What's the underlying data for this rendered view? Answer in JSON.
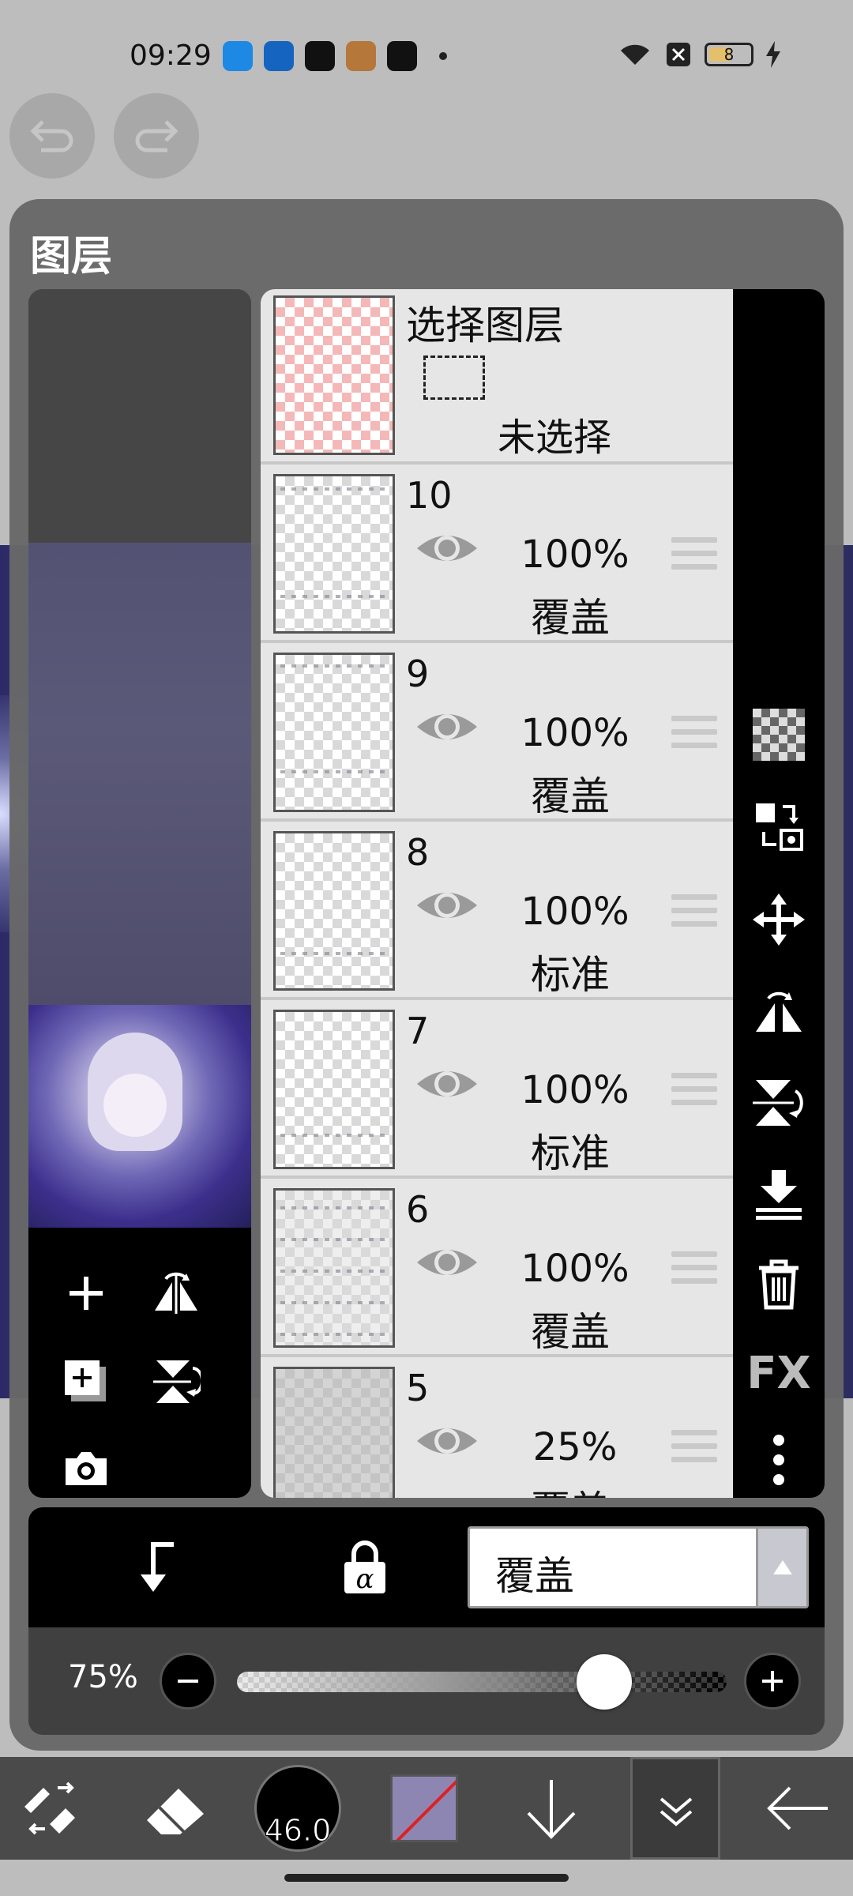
{
  "status_bar": {
    "time": "09:29",
    "battery": "8",
    "app_icons": [
      "blue-app-icon",
      "blue-chat-icon",
      "tiktok-icon",
      "game-avatar-icon",
      "capcut-icon"
    ]
  },
  "panel": {
    "title": "图层"
  },
  "selection_layer": {
    "title": "选择图层",
    "status": "未选择"
  },
  "layers": [
    {
      "number": "10",
      "opacity": "100%",
      "blend": "覆盖"
    },
    {
      "number": "9",
      "opacity": "100%",
      "blend": "覆盖"
    },
    {
      "number": "8",
      "opacity": "100%",
      "blend": "标准"
    },
    {
      "number": "7",
      "opacity": "100%",
      "blend": "标准"
    },
    {
      "number": "6",
      "opacity": "100%",
      "blend": "覆盖"
    },
    {
      "number": "5",
      "opacity": "25%",
      "blend": "覆盖"
    }
  ],
  "right_tools": {
    "fx_label": "FX"
  },
  "blend_mode": {
    "selected": "覆盖"
  },
  "opacity_control": {
    "label": "75%",
    "value": 0.75
  },
  "toolbar": {
    "brush_size": "46.0",
    "color": "#8e86b2"
  },
  "colors": {
    "panel_bg": "#686868",
    "layer_bg": "#e6e6e6",
    "tool_bg": "#000000"
  }
}
